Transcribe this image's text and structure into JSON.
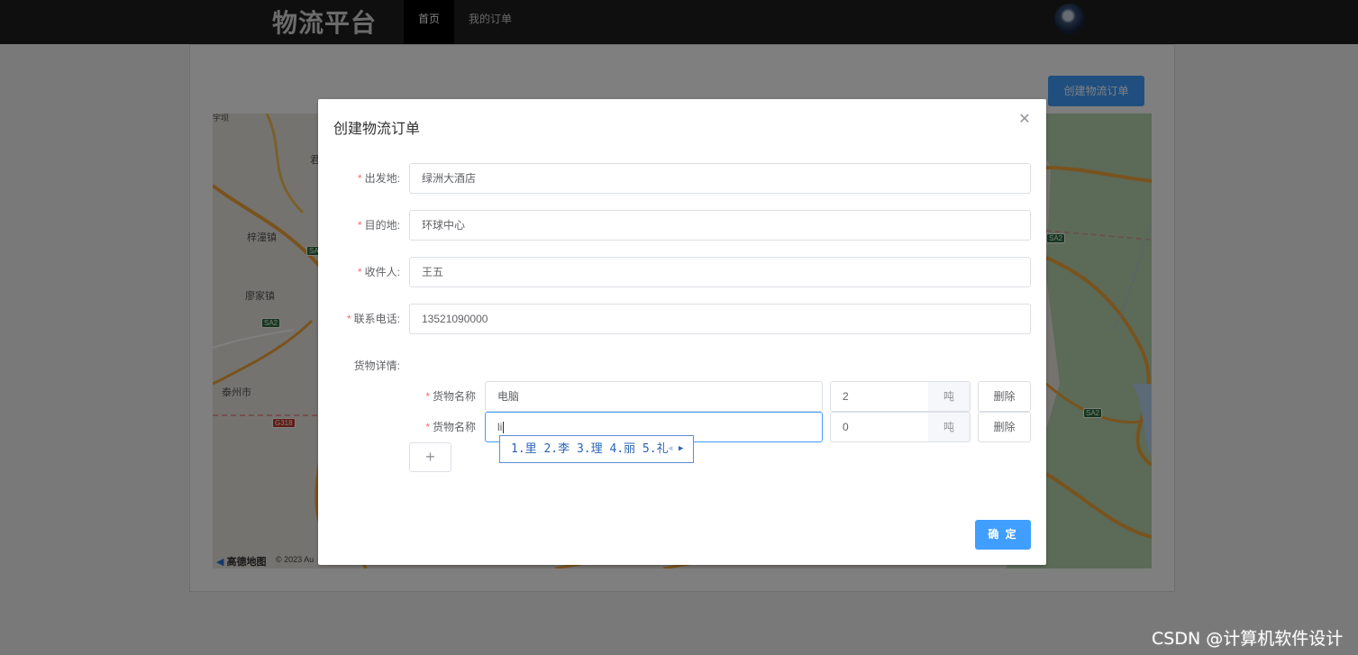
{
  "nav": {
    "brand": "物流平台",
    "items": [
      {
        "label": "首页",
        "active": true
      },
      {
        "label": "我的订单",
        "active": false
      }
    ],
    "avatar_icon": "user-avatar"
  },
  "page": {
    "create_button": "创建物流订单",
    "map": {
      "labels": [
        "梓潼镇",
        "廖家镇",
        "泰州市",
        "宇坝",
        "君"
      ],
      "road_shields": [
        "SA2",
        "SA2",
        "G318",
        "SA2",
        "SA2"
      ],
      "logo": "高德地图",
      "copyright": "© 2023 Au"
    }
  },
  "dialog": {
    "title": "创建物流订单",
    "close_icon": "close-icon",
    "fields": [
      {
        "label": "出发地:",
        "value": "绿洲大酒店",
        "required": true
      },
      {
        "label": "目的地:",
        "value": "环球中心",
        "required": true
      },
      {
        "label": "收件人:",
        "value": "王五",
        "required": true
      },
      {
        "label": "联系电话:",
        "value": "13521090000",
        "required": true
      }
    ],
    "cargo_section_label": "货物详情:",
    "cargo_items": [
      {
        "label": "货物名称",
        "name": "电脑",
        "quantity": "2",
        "unit": "吨",
        "delete_label": "删除"
      },
      {
        "label": "货物名称",
        "name": "li",
        "quantity": "0",
        "unit": "吨",
        "delete_label": "删除"
      }
    ],
    "add_button": "+",
    "confirm_button": "确 定"
  },
  "ime_candidates": {
    "text": "1.里 2.李 3.理 4.丽 5.礼",
    "prev_icon": "chevron-left-icon",
    "next_icon": "chevron-right-icon"
  },
  "watermark": "CSDN @计算机软件设计",
  "colors": {
    "primary": "#409eff",
    "nav_bg": "#1f1f1f",
    "required": "#f56c6c"
  }
}
